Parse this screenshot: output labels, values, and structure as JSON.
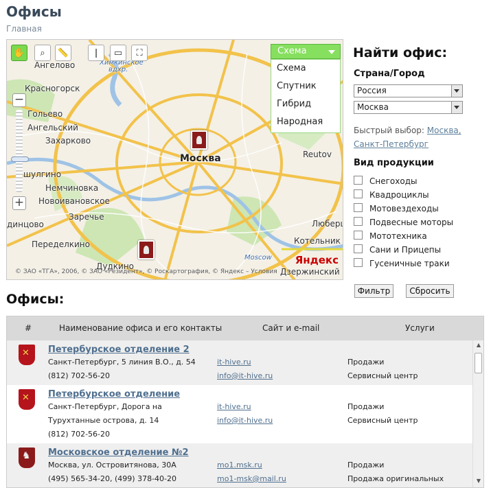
{
  "header": {
    "title": "Офисы",
    "breadcrumb": "Главная"
  },
  "map": {
    "type_selected": "Схема",
    "type_options": [
      "Схема",
      "Спутник",
      "Гибрид",
      "Народная"
    ],
    "labels": {
      "angelovo": "Ангелово",
      "khimki": "Химкинское",
      "vdkhr": "вдхр.",
      "krasnogorsk": "Красногорск",
      "golyevo": "Гольево",
      "angelsky": "Ангельский",
      "zakharkovo": "Захарково",
      "moskva": "Москва",
      "reutov": "Reutov",
      "shulgino": "шулгино",
      "nemchinovka": "Немчиновка",
      "novoivanovskoe": "Новоивановское",
      "zarechye": "Заречье",
      "lyubertsy": "Люберц",
      "dintsovo": "динцово",
      "peredelkino": "Переделкино",
      "kotelniki": "Котельник",
      "dudkino": "Дудкино",
      "moscow_road": "Moscow",
      "dzerzhinsky": "Дзержинский"
    },
    "copyright": "© ЗАО «ТГА», 2006, © ЗАО «Резидент», © Роскартография, © Яндекс – Условия",
    "logo_main": "Яндекс",
    "tools": [
      "hand-icon",
      "zoom-area-icon",
      "ruler-icon",
      "route-icon",
      "traffic-icon",
      "fullscreen-icon"
    ]
  },
  "finder": {
    "title": "Найти офис:",
    "country_city_label": "Страна/Город",
    "country": "Россия",
    "city": "Москва",
    "quick_label": "Быстрый выбор:",
    "quick_moscow": "Москва,",
    "quick_spb": "Санкт-Петербург",
    "products_label": "Вид продукции",
    "products": [
      "Снегоходы",
      "Квадроциклы",
      "Мотовездеходы",
      "Подвесные моторы",
      "Мототехника",
      "Сани и Прицепы",
      "Гусеничные траки"
    ],
    "filter_button": "Фильтр",
    "reset_button": "Сбросить"
  },
  "offices": {
    "title": "Офисы:",
    "columns": [
      "#",
      "Наименование офиса и его контакты",
      "Сайт и e-mail",
      "Услуги"
    ],
    "rows": [
      {
        "name": "Петербурское отделение 2",
        "address": "Санкт-Петербург, 5 линия В.О., д. 54",
        "phone": "(812) 702-56-20",
        "site": "it-hive.ru",
        "email": "info@it-hive.ru",
        "services": [
          "Продажи",
          "Сервисный центр"
        ]
      },
      {
        "name": "Петербурское отделение",
        "address": "Санкт-Петербург, Дорога на Турухтанные острова, д. 14",
        "phone": "(812) 702-56-20",
        "site": "it-hive.ru",
        "email": "info@it-hive.ru",
        "services": [
          "Продажи",
          "Сервисный центр"
        ]
      },
      {
        "name": "Московское отделение №2",
        "address": "Москва, ул. Островитянова, 30А",
        "phone": "(495) 565-34-20, (499) 378-40-20",
        "site": "mo1.msk.ru",
        "email": "mo1-msk@mail.ru",
        "services": [
          "Продажи",
          "Продажа оригинальных"
        ]
      }
    ]
  }
}
